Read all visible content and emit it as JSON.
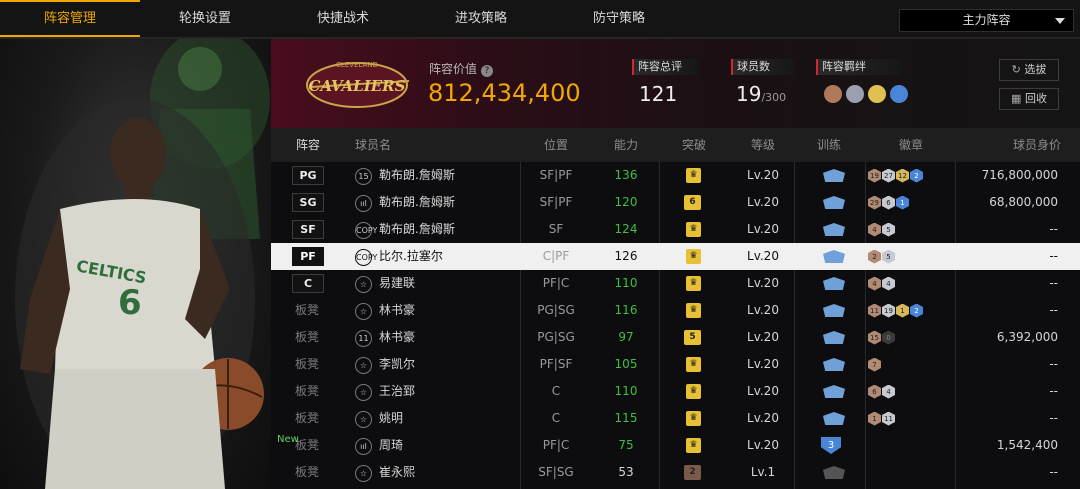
{
  "tabs": [
    "阵容管理",
    "轮换设置",
    "快捷战术",
    "进攻策略",
    "防守策略"
  ],
  "lineup_selector": {
    "value": "主力阵容"
  },
  "team": {
    "logo_text": "CAVALIERS",
    "logo_sub": "CLEVELAND",
    "value_label": "阵容价值",
    "value": "812,434,400",
    "rating_label": "阵容总评",
    "rating": "121",
    "players_label": "球员数",
    "players_count": "19",
    "players_max": "/300",
    "bonds_label": "阵容羁绊",
    "btn_select": "选拔",
    "btn_recycle": "回收"
  },
  "table": {
    "headers": {
      "lineup": "阵容",
      "name": "球员名",
      "pos": "位置",
      "ability": "能力",
      "break": "突破",
      "level": "等级",
      "train": "训练",
      "badge": "徽章",
      "value": "球员身价"
    },
    "rows": [
      {
        "slot": "PG",
        "rank": "15",
        "name": "勒布朗.詹姆斯",
        "pos": "SF|PF",
        "ability": "136",
        "brk": "",
        "level": "Lv.20",
        "badges": [
          [
            "19",
            "bronze"
          ],
          [
            "27",
            "silver"
          ],
          [
            "12",
            "gold"
          ],
          [
            "2",
            "blue"
          ]
        ],
        "value": "716,800,000",
        "slot_type": "box"
      },
      {
        "slot": "SG",
        "rank": "ııl",
        "name": "勒布朗.詹姆斯",
        "pos": "SF|PF",
        "ability": "120",
        "brk": "6",
        "level": "Lv.20",
        "badges": [
          [
            "29",
            "bronze"
          ],
          [
            "6",
            "silver"
          ],
          [
            "1",
            "blue"
          ]
        ],
        "value": "68,800,000",
        "slot_type": "box"
      },
      {
        "slot": "SF",
        "rank": "COPY",
        "name": "勒布朗.詹姆斯",
        "pos": "SF",
        "ability": "124",
        "brk": "",
        "level": "Lv.20",
        "badges": [
          [
            "4",
            "bronze"
          ],
          [
            "5",
            "silver"
          ]
        ],
        "value": "--",
        "slot_type": "box"
      },
      {
        "slot": "PF",
        "rank": "COPY",
        "name": "比尔.拉塞尔",
        "pos": "C|PF",
        "ability": "126",
        "brk": "",
        "level": "Lv.20",
        "badges": [
          [
            "2",
            "bronze"
          ],
          [
            "5",
            "silver"
          ]
        ],
        "value": "--",
        "slot_type": "box"
      },
      {
        "slot": "C",
        "rank": "☆",
        "name": "易建联",
        "pos": "PF|C",
        "ability": "110",
        "brk": "",
        "level": "Lv.20",
        "badges": [
          [
            "4",
            "bronze"
          ],
          [
            "4",
            "silver"
          ]
        ],
        "value": "--",
        "slot_type": "box"
      },
      {
        "slot": "板凳",
        "rank": "☆",
        "name": "林书豪",
        "pos": "PG|SG",
        "ability": "116",
        "brk": "",
        "level": "Lv.20",
        "badges": [
          [
            "11",
            "bronze"
          ],
          [
            "19",
            "silver"
          ],
          [
            "1",
            "gold"
          ],
          [
            "2",
            "blue"
          ]
        ],
        "value": "--",
        "slot_type": "bench"
      },
      {
        "slot": "板凳",
        "rank": "11",
        "name": "林书豪",
        "pos": "PG|SG",
        "ability": "97",
        "brk": "5",
        "level": "Lv.20",
        "badges": [
          [
            "15",
            "bronze"
          ],
          [
            "0",
            "dark"
          ]
        ],
        "value": "6,392,000",
        "slot_type": "bench"
      },
      {
        "slot": "板凳",
        "rank": "☆",
        "name": "李凯尔",
        "pos": "PF|SF",
        "ability": "105",
        "brk": "",
        "level": "Lv.20",
        "badges": [
          [
            "7",
            "bronze"
          ]
        ],
        "value": "--",
        "slot_type": "bench"
      },
      {
        "slot": "板凳",
        "rank": "☆",
        "name": "王治郅",
        "pos": "C",
        "ability": "110",
        "brk": "",
        "level": "Lv.20",
        "badges": [
          [
            "6",
            "bronze"
          ],
          [
            "4",
            "silver"
          ]
        ],
        "value": "--",
        "slot_type": "bench"
      },
      {
        "slot": "板凳",
        "rank": "☆",
        "name": "姚明",
        "pos": "C",
        "ability": "115",
        "brk": "",
        "level": "Lv.20",
        "badges": [
          [
            "1",
            "bronze"
          ],
          [
            "11",
            "silver"
          ]
        ],
        "value": "--",
        "slot_type": "bench"
      },
      {
        "slot": "板凳",
        "rank": "ııl",
        "name": "周琦",
        "pos": "PF|C",
        "ability": "75",
        "brk": "",
        "level": "Lv.20",
        "badges": [],
        "value": "1,542,400",
        "slot_type": "bench",
        "new": "New",
        "train": "3"
      },
      {
        "slot": "板凳",
        "rank": "☆",
        "name": "崔永熙",
        "pos": "SF|SG",
        "ability": "53",
        "brk": "2",
        "level": "Lv.1",
        "badges": [],
        "value": "--",
        "slot_type": "bench"
      }
    ]
  },
  "colors": {
    "accent": "#f0a800",
    "highlight_row": "#f0f0f0",
    "green": "#3fbf3f",
    "red_marker": "#d1263a"
  }
}
